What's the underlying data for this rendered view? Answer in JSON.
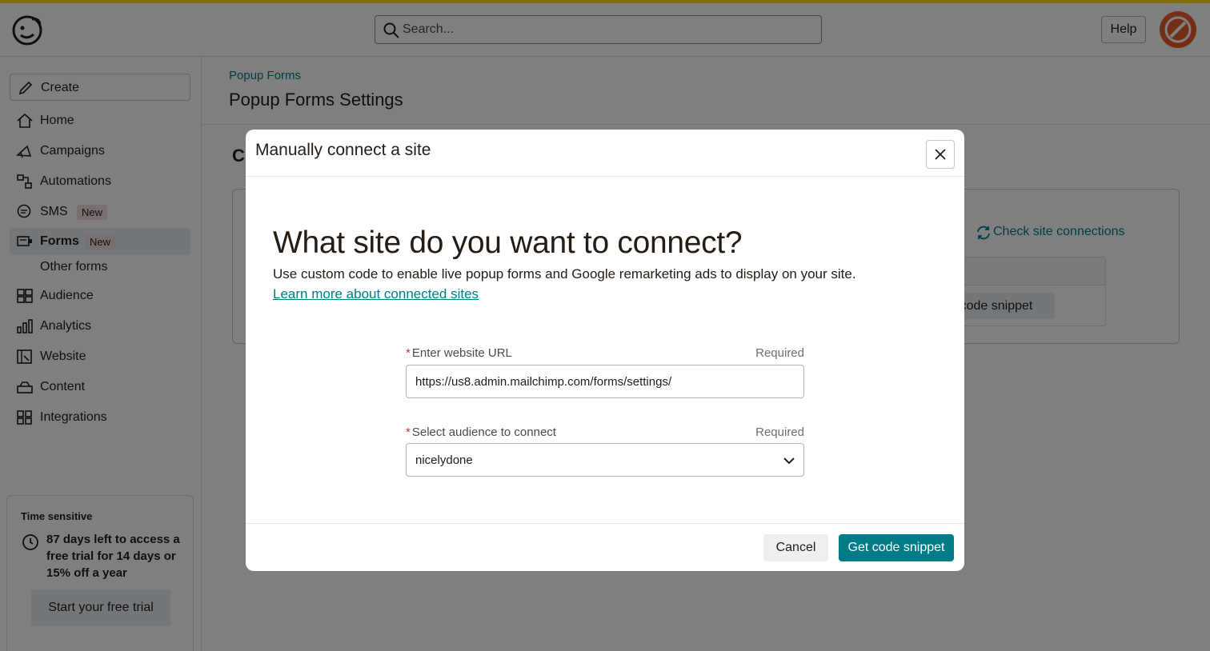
{
  "topbar": {
    "search_placeholder": "Search...",
    "help_label": "Help",
    "stripe_color": "#ffe01b"
  },
  "sidebar": {
    "create_label": "Create",
    "items": [
      {
        "label": "Home",
        "icon": "home-icon"
      },
      {
        "label": "Campaigns",
        "icon": "megaphone-icon"
      },
      {
        "label": "Automations",
        "icon": "automations-icon"
      },
      {
        "label": "SMS",
        "icon": "chat-bubble-icon",
        "badge": "New"
      },
      {
        "label": "Forms",
        "icon": "form-icon",
        "badge": "New",
        "active": true
      },
      {
        "label": "Audience",
        "icon": "audience-icon"
      },
      {
        "label": "Analytics",
        "icon": "bar-chart-icon"
      },
      {
        "label": "Website",
        "icon": "website-icon"
      },
      {
        "label": "Content",
        "icon": "content-icon"
      },
      {
        "label": "Integrations",
        "icon": "grid-icon"
      }
    ],
    "sub_item": "Other forms",
    "trial": {
      "label": "Time sensitive",
      "text": "87 days left to access a free trial for 14 days or 15% off a year",
      "button": "Start your free trial"
    }
  },
  "main": {
    "breadcrumb": "Popup Forms",
    "title": "Popup Forms Settings",
    "bg_heading": "C",
    "check_connections": "Check site connections",
    "bg_button": "code snippet"
  },
  "modal": {
    "title": "Manually connect a site",
    "heading": "What site do you want to connect?",
    "description": "Use custom code to enable live popup forms and Google remarketing ads to display on your site.",
    "learn_link": "Learn more about connected sites",
    "url_field": {
      "label": "Enter website URL",
      "required": "Required",
      "value": "https://us8.admin.mailchimp.com/forms/settings/"
    },
    "audience_field": {
      "label": "Select audience to connect",
      "required": "Required",
      "value": "nicelydone"
    },
    "cancel_label": "Cancel",
    "primary_label": "Get code snippet",
    "accent_color": "#007c89"
  }
}
